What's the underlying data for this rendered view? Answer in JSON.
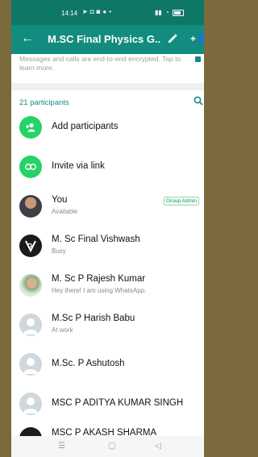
{
  "status_bar": {
    "time": "14:14"
  },
  "appbar": {
    "title": "M.SC Final Physics G..."
  },
  "encryption": {
    "text": "Messages and calls are end-to-end encrypted. Tap to learn more."
  },
  "participants": {
    "count_label": "21 participants",
    "actions": [
      {
        "label": "Add participants"
      },
      {
        "label": "Invite via link"
      }
    ],
    "members": [
      {
        "name": "You",
        "status": "Available",
        "badge": "Group Admin"
      },
      {
        "name": "M. Sc Final Vishwash",
        "status": "Busy"
      },
      {
        "name": "M. Sc P Rajesh Kumar",
        "status": "Hey there! I am using WhatsApp."
      },
      {
        "name": "M.Sc P Harish Babu",
        "status": "At work"
      },
      {
        "name": "M.Sc. P Ashutosh",
        "status": ""
      },
      {
        "name": "MSC P ADITYA KUMAR SINGH",
        "status": ""
      },
      {
        "name": "MSC P AKASH SHARMA",
        "status": ""
      }
    ]
  },
  "colors": {
    "primary": "#128c7e",
    "accent": "#25d366",
    "status_bar": "#0f7766"
  }
}
